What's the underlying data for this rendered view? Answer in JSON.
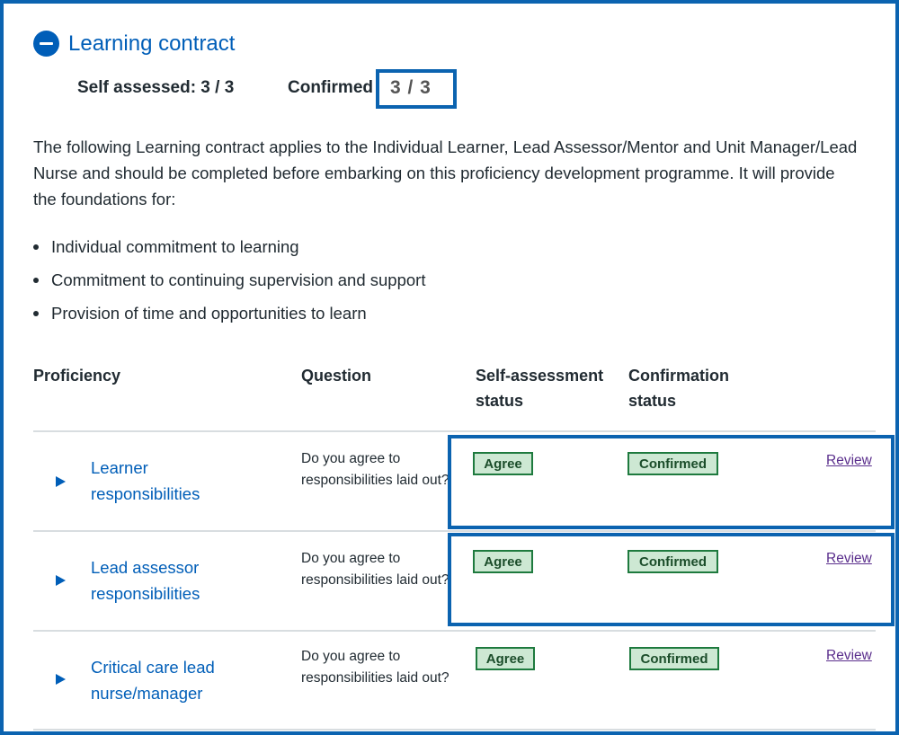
{
  "section": {
    "title": "Learning contract",
    "toggle_icon": "minus-circle-icon"
  },
  "counts": {
    "self_assessed": "Self assessed: 3 / 3",
    "confirmed_label": "Confirmed",
    "confirmed_value": "3 / 3"
  },
  "intro": "The following Learning contract applies to the Individual Learner, Lead Assessor/Mentor and Unit Manager/Lead Nurse and should be completed before embarking on this proficiency development programme. It will provide the foundations for:",
  "bullets": [
    "Individual commitment to learning",
    "Commitment to continuing supervision and support",
    "Provision of time and opportunities to learn"
  ],
  "table": {
    "headers": {
      "proficiency": "Proficiency",
      "question": "Question",
      "self_assessment_1": "Self-assessment",
      "self_assessment_2": "status",
      "confirmation_1": "Confirmation",
      "confirmation_2": "status"
    },
    "rows": [
      {
        "proficiency_1": "Learner",
        "proficiency_2": "responsibilities",
        "question": "Do you agree to responsibilities laid out?",
        "self_status": "Agree",
        "confirmation_status": "Confirmed",
        "action": "Review"
      },
      {
        "proficiency_1": "Lead assessor",
        "proficiency_2": "responsibilities",
        "question": "Do you agree to responsibilities laid out?",
        "self_status": "Agree",
        "confirmation_status": "Confirmed",
        "action": "Review"
      },
      {
        "proficiency_1": "Critical care lead",
        "proficiency_2": "nurse/manager",
        "question": "Do you agree to responsibilities laid out?",
        "self_status": "Agree",
        "confirmation_status": "Confirmed",
        "action": "Review"
      }
    ]
  },
  "colors": {
    "accent": "#005eb8",
    "highlight_border": "#0b63b0",
    "badge_bg": "#cde8d3",
    "badge_border": "#1e7a3e",
    "link_visited": "#5a2e8c"
  }
}
